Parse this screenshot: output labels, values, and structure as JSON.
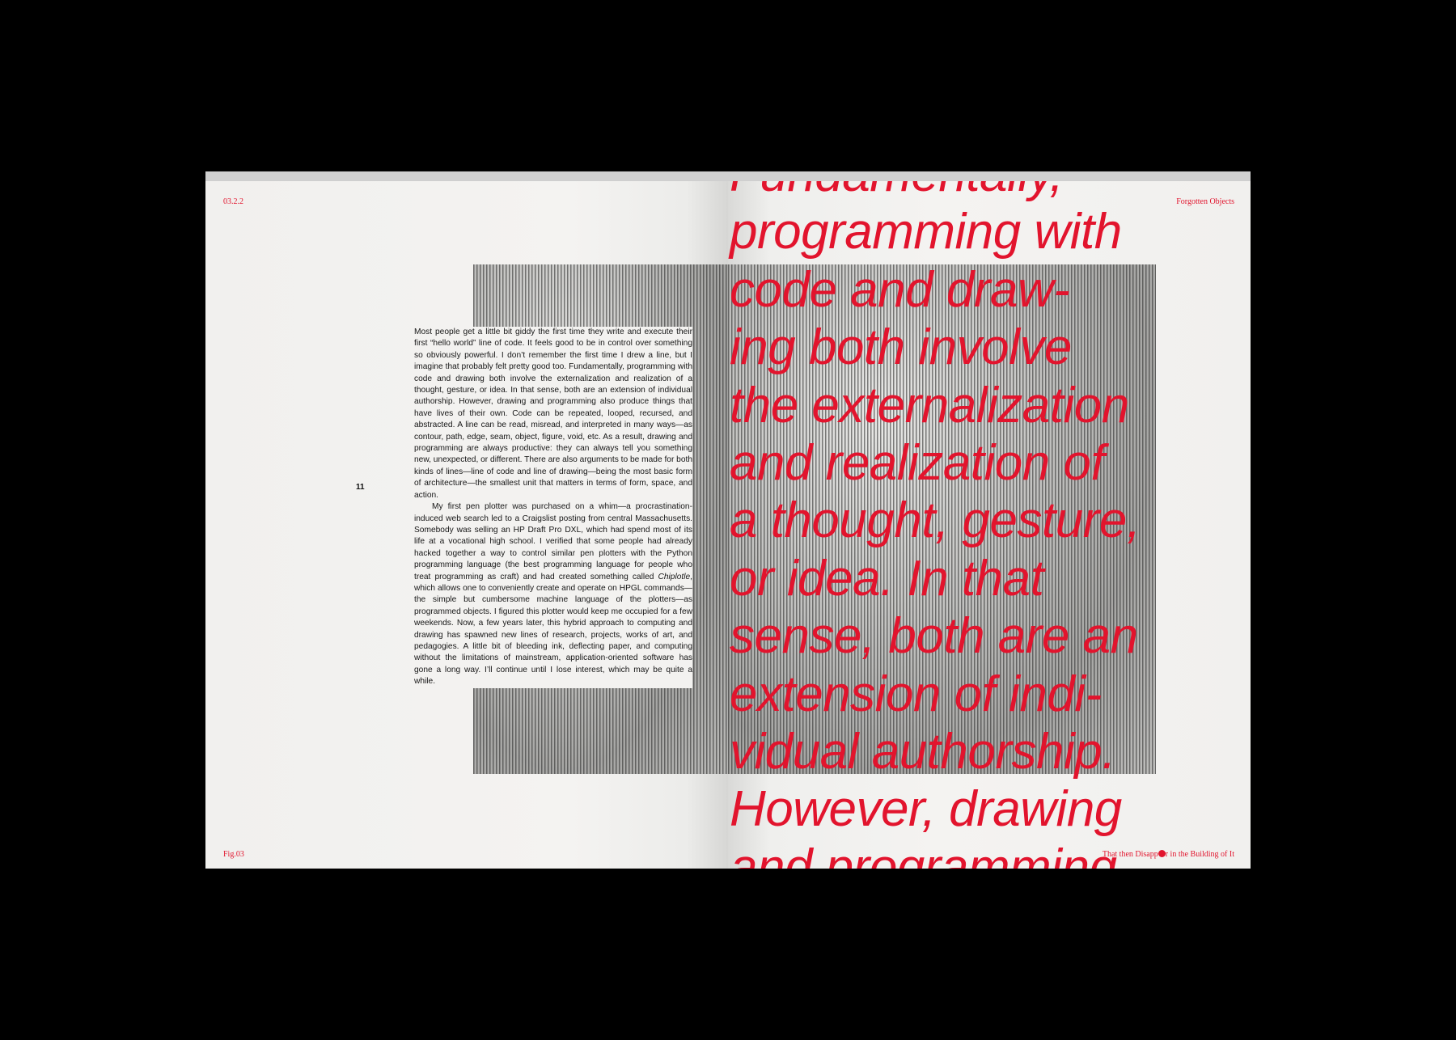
{
  "left_page": {
    "folio_top": "03.2.2",
    "folio_bottom": "Fig.03",
    "page_number": "11",
    "paragraph_1": "Most people get a little bit giddy the first time they write and execute their first “hello world” line of code. It feels good to be in control over something so obviously powerful. I don’t remember the first time I drew a line, but I imagine that probably felt pretty good too. Fundamentally, programming with code and drawing both involve the externalization and realization of a thought, gesture, or idea. In that sense, both are an extension of individual authorship. However, drawing and programming also produce things that have lives of their own. Code can be repeated, looped, recursed, and abstracted. A line can be read, misread, and interpreted in many ways—as contour, path, edge, seam, object, figure, void, etc. As a result, drawing and programming are always productive: they can always tell you something new, unexpected, or different. There are also arguments to be made for both kinds of lines—line of code and line of drawing—being the most basic form of architecture—the smallest unit that matters in terms of form, space, and action.",
    "paragraph_2a": "My first pen plotter was purchased on a whim—a procrastination-induced web search led to a Craigslist posting from central Massachusetts. Somebody was selling an HP Draft Pro DXL, which had spend most of its life at a vocational high school. I verified that some people had already hacked together a way to control similar pen plotters with the Python programming language (the best programming language for people who treat programming as craft) and had created something called ",
    "paragraph_2_italic": "Chiplotle",
    "paragraph_2b": ", which allows one to conveniently create and operate on HPGL commands—the simple but cumbersome machine language of the plotters—as programmed objects. I figured this plotter would keep me occupied for a few weekends. Now, a few years later, this hybrid approach to computing and drawing has spawned new lines of research, projects, works of art, and pedagogies. A little bit of bleeding ink, deflecting paper, and computing without the limitations of mainstream, application-oriented software has gone a long way. I’ll continue until I lose interest, which may be quite a while."
  },
  "right_page": {
    "folio_top": "Forgotten Objects",
    "folio_bottom_a": "That then Disapp",
    "folio_bottom_b": "r in the Building of It",
    "pull_quote": "Fundamentally,\nprogramming with\ncode and draw-\ning both involve\nthe externalization\nand realization of\na thought, gesture,\nor idea. In that\nsense, both are an\nextension of indi-\nvidual authorship.\nHowever, drawing\nand programming"
  },
  "colors": {
    "accent_red": "#e2142d",
    "background": "#000000",
    "paper": "#f2f1ef"
  }
}
